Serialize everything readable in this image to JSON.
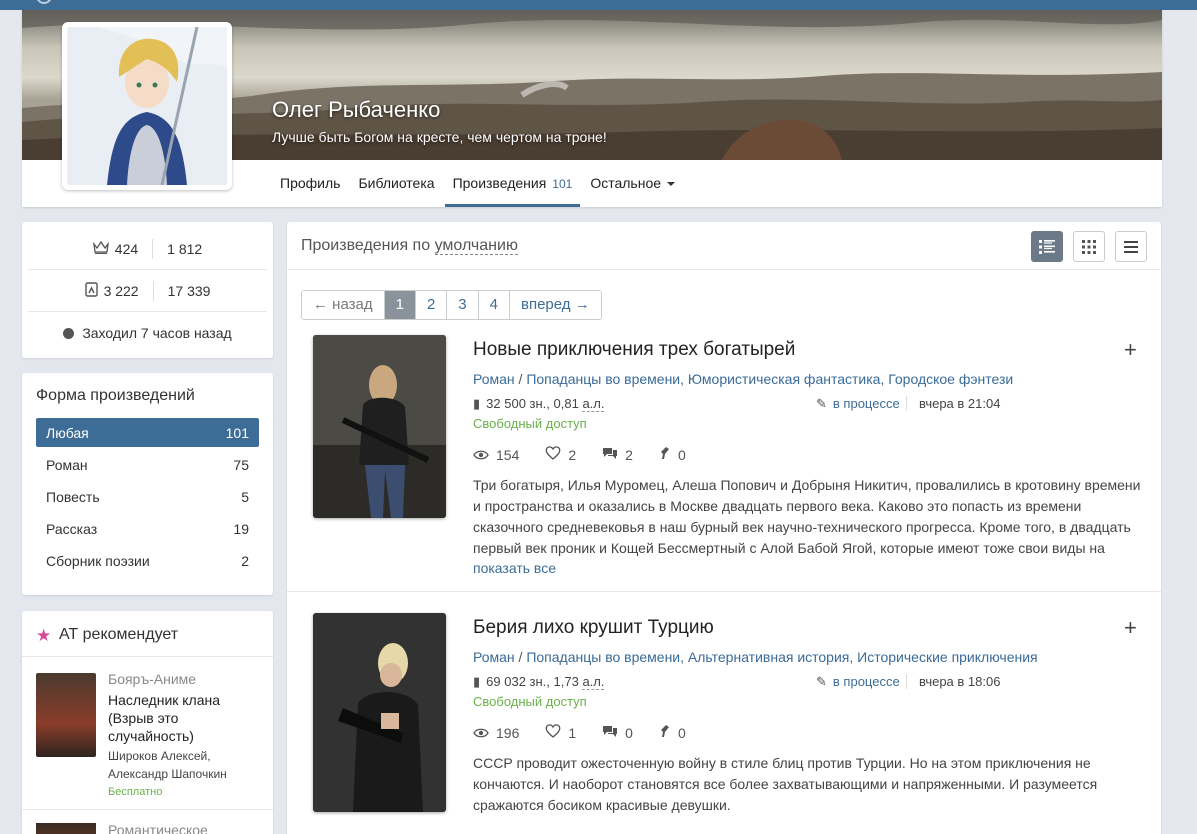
{
  "profile": {
    "name": "Олег Рыбаченко",
    "motto": "Лучше быть Богом на кресте, чем чертом на троне!",
    "tabs": [
      {
        "label": "Профиль"
      },
      {
        "label": "Библиотека"
      },
      {
        "label": "Произведения",
        "count": "101",
        "active": true
      },
      {
        "label": "Остальное",
        "dropdown": true
      }
    ]
  },
  "stats": {
    "row1": {
      "a": "424",
      "b": "1 812"
    },
    "row2": {
      "a": "3 222",
      "b": "17 339"
    },
    "last_seen": "Заходил 7 часов назад"
  },
  "forms": {
    "title": "Форма произведений",
    "items": [
      {
        "label": "Любая",
        "count": "101",
        "selected": true
      },
      {
        "label": "Роман",
        "count": "75"
      },
      {
        "label": "Повесть",
        "count": "5"
      },
      {
        "label": "Рассказ",
        "count": "19"
      },
      {
        "label": "Сборник поэзии",
        "count": "2"
      }
    ]
  },
  "recommend": {
    "title": "АТ рекомендует",
    "items": [
      {
        "genre": "Бояръ-Аниме",
        "title": "Наследник клана (Взрыв это случайность)",
        "author": "Широков Алексей, Александр Шапочкин",
        "price": "Бесплатно"
      },
      {
        "genre": "Романтическое"
      }
    ]
  },
  "works": {
    "sort_prefix": "Произведения по",
    "sort_value": "умолчанию",
    "pager": {
      "prev": "← назад",
      "pages": [
        "1",
        "2",
        "3",
        "4"
      ],
      "current": "1",
      "next": "вперед →"
    },
    "books": [
      {
        "title": "Новые приключения трех богатырей",
        "genres": [
          "Роман",
          "Попаданцы во времени",
          "Юмористическая фантастика",
          "Городское фэнтези"
        ],
        "size": "32 500 зн., 0,81",
        "size_unit": "а.л.",
        "status": "в процессе",
        "date": "вчера в 21:04",
        "access": "Свободный доступ",
        "views": "154",
        "likes": "2",
        "comments": "2",
        "rewards": "0",
        "description": "Три богатыря, Илья Муромец, Алеша Попович и Добрыня Никитич, провалились в кротовину времени и пространства и оказались в Москве двадцать первого века. Каково это попасть из времени сказочного средневековья в наш бурный век научно-технического прогресса. Кроме того, в двадцать первый век проник и Кощей Бессмертный с Алой Бабой Ягой, которые имеют тоже свои виды на",
        "more": "показать все"
      },
      {
        "title": "Берия лихо крушит Турцию",
        "genres": [
          "Роман",
          "Попаданцы во времени",
          "Альтернативная история",
          "Исторические приключения"
        ],
        "size": "69 032 зн., 1,73",
        "size_unit": "а.л.",
        "status": "в процессе",
        "date": "вчера в 18:06",
        "access": "Свободный доступ",
        "views": "196",
        "likes": "1",
        "comments": "0",
        "rewards": "0",
        "description": "СССР проводит ожесточенную войну в стиле блиц против Турции. Но на этом приключения не кончаются. И наоборот становятся все более захватывающими и напряженными. И разумеется сражаются босиком красивые девушки."
      }
    ]
  },
  "colors": {
    "accent": "#3d6d96",
    "free": "#6ab04c",
    "background": "#e4e8ee"
  }
}
